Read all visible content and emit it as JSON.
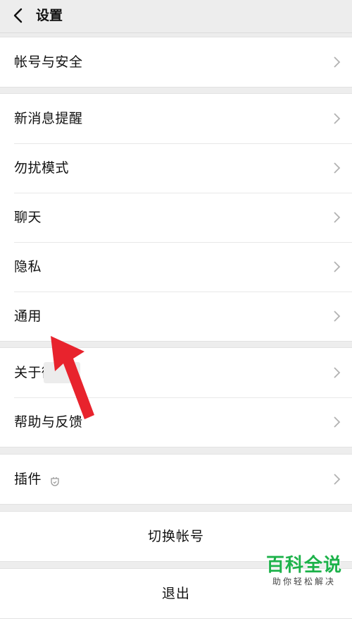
{
  "header": {
    "title": "设置"
  },
  "groups": {
    "account": [
      {
        "label": "帐号与安全"
      }
    ],
    "settings": [
      {
        "label": "新消息提醒"
      },
      {
        "label": "勿扰模式"
      },
      {
        "label": "聊天"
      },
      {
        "label": "隐私"
      },
      {
        "label": "通用"
      }
    ],
    "about": [
      {
        "label": "关于微信"
      },
      {
        "label": "帮助与反馈"
      }
    ],
    "plugins": [
      {
        "label": "插件"
      }
    ]
  },
  "actions": {
    "switch_account": "切换帐号",
    "logout": "退出"
  },
  "watermark": {
    "title": "百科全说",
    "subtitle": "助你轻松解决"
  },
  "colors": {
    "background": "#ededed",
    "row": "#ffffff",
    "arrow": "#e8232d",
    "watermark": "#1db24a"
  }
}
